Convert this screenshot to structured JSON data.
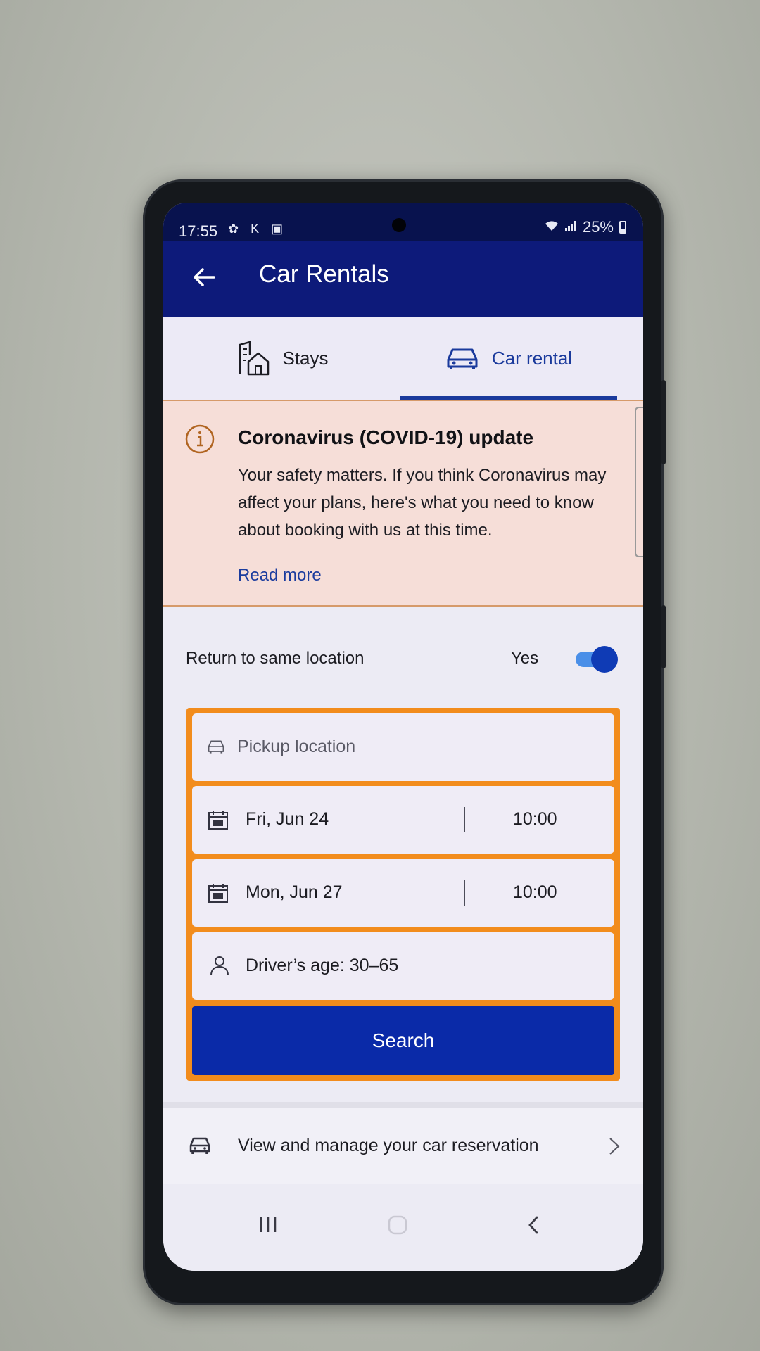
{
  "status_bar": {
    "time": "17:55",
    "left_icons": "✿ K ▣",
    "battery": "25%"
  },
  "app_bar": {
    "title": "Car Rentals"
  },
  "tabs": [
    {
      "label": "Stays",
      "icon": "house-building-icon",
      "selected": false
    },
    {
      "label": "Car rental",
      "icon": "car-icon",
      "selected": true
    }
  ],
  "covid_banner": {
    "title": "Coronavirus (COVID-19) update",
    "body": "Your safety matters. If you think Coronavirus may affect your plans, here's what you need to know about booking with us at this time.",
    "link": "Read more"
  },
  "return_location": {
    "label": "Return to same location",
    "value": "Yes",
    "enabled": true
  },
  "search_form": {
    "pickup_placeholder": "Pickup location",
    "pickup_date": "Fri, Jun 24",
    "pickup_time": "10:00",
    "dropoff_date": "Mon, Jun 27",
    "dropoff_time": "10:00",
    "driver_age": "Driver’s age: 30–65",
    "search_label": "Search"
  },
  "manage": {
    "label": "View and manage your car reservation"
  },
  "colors": {
    "app_bar": "#0d1a7a",
    "accent": "#1a3a9c",
    "form_border": "#f28c1c",
    "search_button": "#0a2aa8",
    "covid_background": "#f6ded8"
  }
}
